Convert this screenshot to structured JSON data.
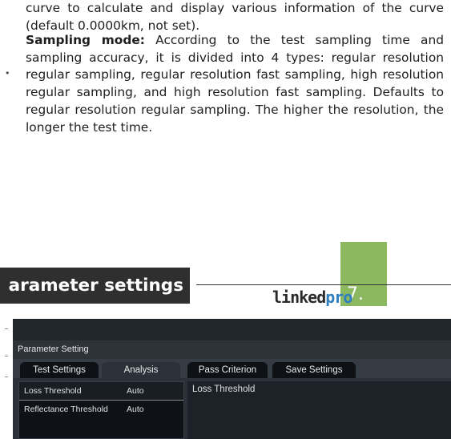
{
  "document": {
    "paragraph1": "curve to calculate and display various information of the curve (default 0.0000km, not set).",
    "sampling_mode_label": "Sampling mode:",
    "sampling_mode_text": " According to the test sampling time and sampling accuracy, it is divided into 4 types: regular resolution regular sampling, regular resolution fast sampling, high resolution regular sampling, and high resolution fast sampling. Defaults to regular resolution regular sampling. The higher the resolution, the longer the test time.",
    "bullet": "•",
    "section_title": "arameter settings",
    "page_number": "7.",
    "logo": {
      "part1": "linked",
      "part2": "pro"
    }
  },
  "screenshot": {
    "window_title": "Parameter Setting",
    "tabs": [
      {
        "label": "Test Settings",
        "active": false
      },
      {
        "label": "Analysis",
        "active": true
      },
      {
        "label": "Pass Criterion",
        "active": false
      },
      {
        "label": "Save Settings",
        "active": false
      }
    ],
    "list": [
      {
        "name": "Loss Threshold",
        "value": "Auto",
        "selected": true
      },
      {
        "name": "Reflectance Threshold",
        "value": "Auto",
        "selected": false
      }
    ],
    "detail_title": "Loss Threshold"
  },
  "colors": {
    "accent_green": "#8cb85f",
    "logo_blue": "#2e7fc2",
    "section_bar": "#2f2f2f",
    "screen_bg": "#141a20"
  }
}
